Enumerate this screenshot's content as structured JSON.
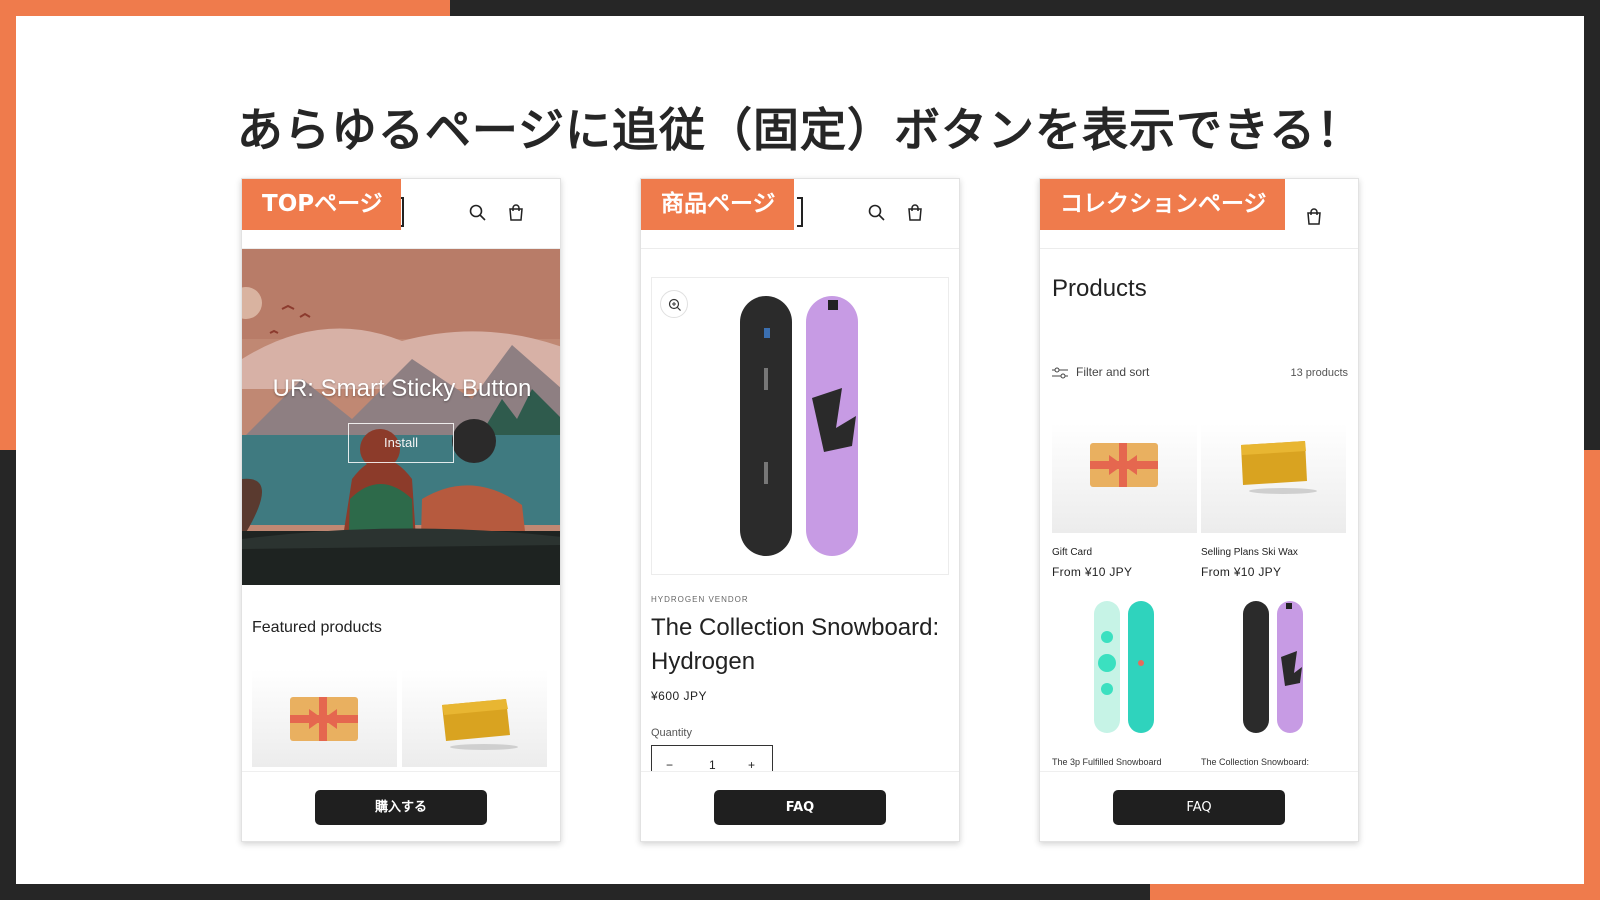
{
  "headline": "あらゆるページに追従（固定）ボタンを表示できる！",
  "colors": {
    "accent": "#ef7b4c",
    "dark": "#262626",
    "button": "#1f1f1f"
  },
  "screens": [
    {
      "tag": "TOPページ",
      "hero_title": "UR: Smart Sticky Button",
      "hero_button": "Install",
      "section_title": "Featured products",
      "sticky_button": "購入する",
      "icons": [
        "search-icon",
        "cart-icon"
      ]
    },
    {
      "tag": "商品ページ",
      "vendor": "HYDROGEN VENDOR",
      "product_title": "The Collection Snowboard: Hydrogen",
      "price": "¥600 JPY",
      "quantity_label": "Quantity",
      "quantity_value": "1",
      "minus": "−",
      "plus": "+",
      "sticky_button": "FAQ",
      "icons": [
        "search-icon",
        "cart-icon",
        "zoom-icon"
      ]
    },
    {
      "tag": "コレクションページ",
      "collection_title": "Products",
      "filter_label": "Filter and sort",
      "product_count": "13 products",
      "cards": [
        {
          "name": "Gift Card",
          "price": "From ¥10 JPY"
        },
        {
          "name": "Selling Plans Ski Wax",
          "price": "From ¥10 JPY"
        },
        {
          "name": "The 3p Fulfilled Snowboard"
        },
        {
          "name": "The Collection Snowboard:"
        }
      ],
      "sticky_button": "FAQ",
      "icons": [
        "cart-icon",
        "filter-icon"
      ]
    }
  ]
}
